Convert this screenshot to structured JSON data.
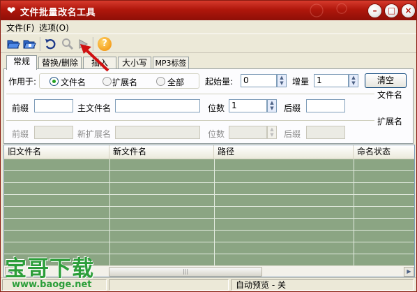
{
  "app": {
    "title": "文件批量改名工具",
    "icon": "heart-icon"
  },
  "window_controls": {
    "minimize": "–",
    "maximize": "□",
    "close": "×"
  },
  "menu": {
    "file": "文件(F)",
    "options": "选项(O)"
  },
  "toolbar": {
    "icons": [
      "open-folder-icon",
      "open-file-icon",
      "undo-icon",
      "preview-icon",
      "run-icon",
      "help-icon"
    ],
    "help_glyph": "?"
  },
  "tabs": [
    {
      "label": "常规",
      "active": true
    },
    {
      "label": "替换/删除",
      "active": false
    },
    {
      "label": "插入",
      "active": false
    },
    {
      "label": "大小写",
      "active": false
    },
    {
      "label": "MP3标签",
      "active": false
    }
  ],
  "general": {
    "apply_to_label": "作用于:",
    "radios": [
      {
        "label": "文件名",
        "selected": true
      },
      {
        "label": "扩展名",
        "selected": false
      },
      {
        "label": "全部",
        "selected": false
      }
    ],
    "start_label": "起始量:",
    "start_value": "0",
    "step_label": "增量",
    "step_value": "1",
    "clear_label": "清空",
    "filename_group": "文件名",
    "prefix_label": "前缀",
    "prefix_value": "",
    "main_name_label": "主文件名",
    "main_name_value": "",
    "digits_label": "位数",
    "digits_value": "1",
    "suffix_label": "后缀",
    "suffix_value": "",
    "ext_group": "扩展名",
    "ext_prefix_label": "前缀",
    "new_ext_label": "新扩展名",
    "ext_digits_label": "位数",
    "ext_suffix_label": "后缀"
  },
  "list": {
    "columns": [
      "旧文件名",
      "新文件名",
      "路径",
      "命名状态"
    ],
    "row_count": 9,
    "row_color": "#8ba583",
    "scroll_grip": "|||"
  },
  "status": {
    "left": "",
    "middle": "",
    "right": "自动预览 - 关"
  },
  "watermark": {
    "text": "宝哥下载",
    "url": "www.baoge.net",
    "color": "#2c9e3a"
  },
  "accent_colors": {
    "titlebar": "#b0170c",
    "annotation_arrow": "#d01010"
  }
}
